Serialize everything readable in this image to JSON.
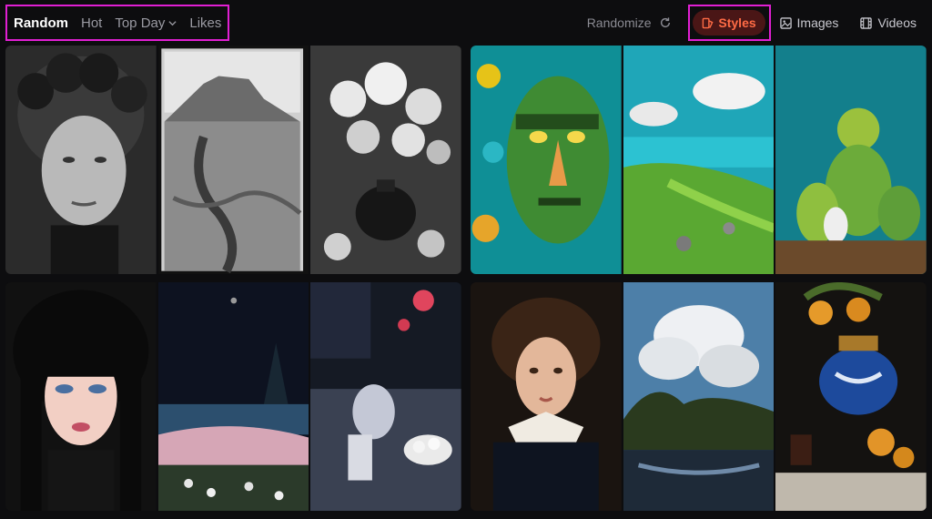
{
  "nav": {
    "tabs": [
      {
        "label": "Random",
        "active": true
      },
      {
        "label": "Hot",
        "active": false
      },
      {
        "label": "Top Day",
        "active": false,
        "has_dropdown": true
      },
      {
        "label": "Likes",
        "active": false
      }
    ]
  },
  "toolbar": {
    "randomize_label": "Randomize",
    "styles_label": "Styles",
    "images_label": "Images",
    "videos_label": "Videos"
  },
  "icons": [
    "refresh-icon",
    "styles-icon",
    "image-icon",
    "film-icon",
    "chevron-down-icon"
  ],
  "colors": {
    "highlight": "#e11fd3",
    "styles_bg": "#4a1616",
    "styles_fg": "#ff6b45",
    "background": "#0d0d0f"
  },
  "gallery": [
    {
      "style": "black-and-white photography",
      "images": [
        "curly-haired man portrait",
        "mesa landscape",
        "flowers in vase"
      ]
    },
    {
      "style": "teal cartoon 3D",
      "images": [
        "green stone face",
        "coastal cliffs",
        "pear figures"
      ]
    },
    {
      "style": "anime night",
      "images": [
        "dark-haired girl",
        "night shore",
        "bar table with glasses"
      ]
    },
    {
      "style": "baroque painting",
      "images": [
        "young woman portrait",
        "cloudy river landscape",
        "still life with blue vase"
      ]
    }
  ]
}
